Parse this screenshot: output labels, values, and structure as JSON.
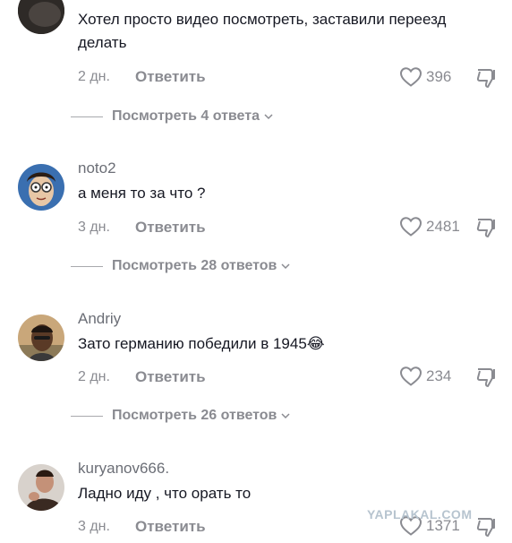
{
  "comments": [
    {
      "username": "",
      "text": "Хотел просто видео посмотреть, заставили переезд делать",
      "time": "2 дн.",
      "reply_label": "Ответить",
      "likes": "396",
      "view_replies": "Посмотреть 4 ответа"
    },
    {
      "username": "noto2",
      "text": "а меня то за что ?",
      "time": "3 дн.",
      "reply_label": "Ответить",
      "likes": "2481",
      "view_replies": "Посмотреть 28 ответов"
    },
    {
      "username": "Andriy",
      "text": "Зато германию победили в 1945😂",
      "time": "2 дн.",
      "reply_label": "Ответить",
      "likes": "234",
      "view_replies": "Посмотреть 26 ответов"
    },
    {
      "username": "kuryanov666.",
      "text": "Ладно иду , что орать то",
      "time": "3 дн.",
      "reply_label": "Ответить",
      "likes": "1371"
    }
  ],
  "watermark": "YAPLAKAL.COM",
  "icons": {
    "like": "heart-outline-icon",
    "dislike": "thumbs-down-icon",
    "expand": "chevron-down-icon"
  },
  "colors": {
    "text": "#161823",
    "secondary": "#8a8b91"
  }
}
